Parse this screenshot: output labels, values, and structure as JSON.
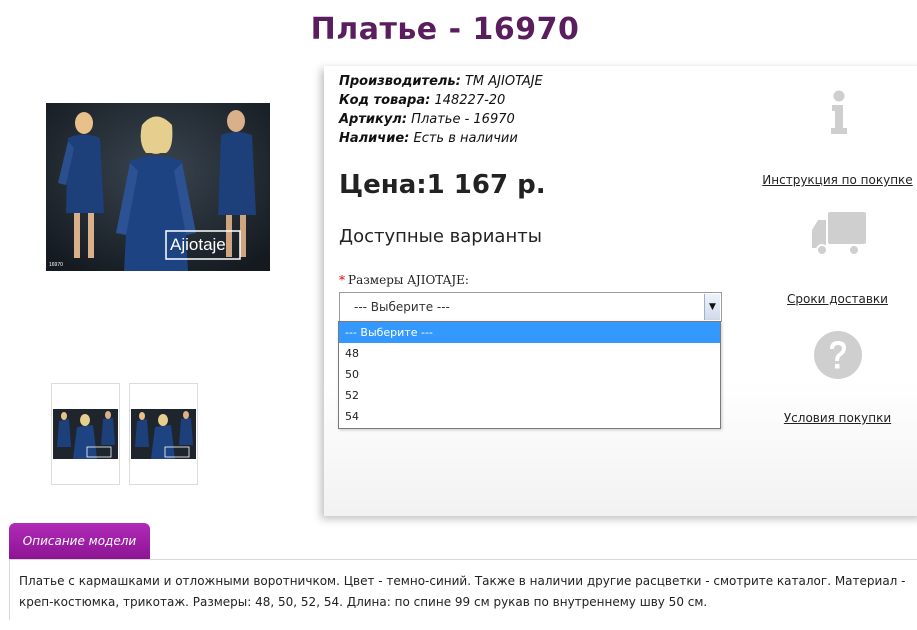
{
  "page": {
    "title": "Платье - 16970"
  },
  "product": {
    "brand_label": "Производитель:",
    "brand_value": "ТМ AJIOTAJE",
    "code_label": "Код товара:",
    "code_value": "148227-20",
    "sku_label": "Артикул:",
    "sku_value": "Платье - 16970",
    "stock_label": "Наличие:",
    "stock_value": "Есть в наличии",
    "price": "Цена:1 167 р.",
    "image_logo": "Ajiotaje",
    "image_code": "16970"
  },
  "options": {
    "title": "Доступные варианты",
    "size_label": "Размеры AJIOTAJE:",
    "required_mark": "*",
    "select_value": "--- Выберите ---",
    "items": [
      "--- Выберите ---",
      "48",
      "50",
      "52",
      "54"
    ]
  },
  "sidebar": {
    "instructions": "Инструкция по покупке",
    "delivery": "Сроки доставки",
    "conditions": "Условия покупки"
  },
  "description": {
    "tab_label": "Описание модели",
    "text": "Платье с кармашками и отложными воротничком. Цвет - темно-синий. Также в наличии другие расцветки - смотрите каталог. Материал - креп-костюмка, трикотаж. Размеры: 48, 50, 52, 54. Длина: по спине 99 см рукав по внутреннему шву 50 см."
  },
  "colors": {
    "title": "#5a1d5e",
    "tab": "#9f1fa7",
    "highlight": "#3399ff"
  }
}
